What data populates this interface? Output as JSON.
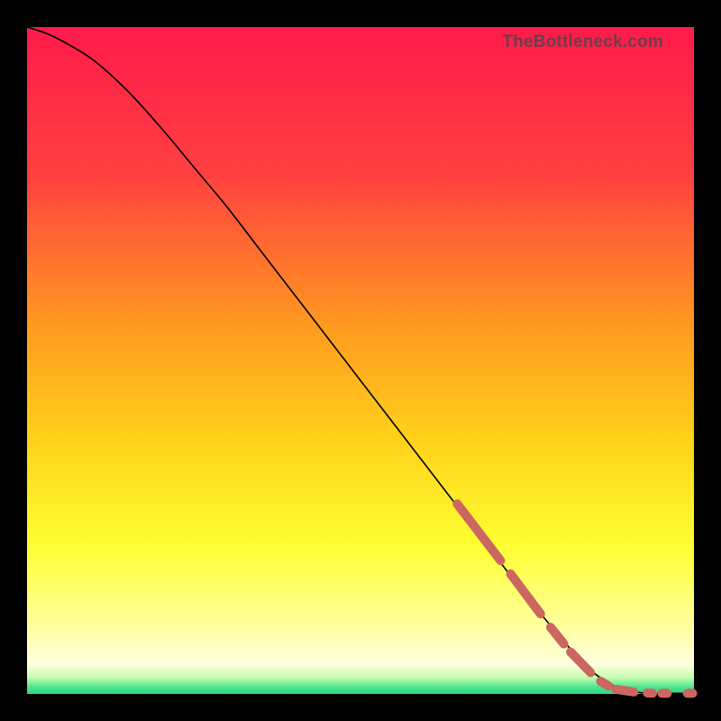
{
  "watermark": "TheBottleneck.com",
  "colors": {
    "curve": "#000000",
    "dash": "#cc6660",
    "gradient_stops": [
      {
        "offset": 0.0,
        "color": "#ff1a4b"
      },
      {
        "offset": 0.22,
        "color": "#ff4040"
      },
      {
        "offset": 0.45,
        "color": "#ff9a1f"
      },
      {
        "offset": 0.62,
        "color": "#ffd21a"
      },
      {
        "offset": 0.78,
        "color": "#ffff33"
      },
      {
        "offset": 0.9,
        "color": "#ffffa0"
      },
      {
        "offset": 0.955,
        "color": "#ffffe0"
      },
      {
        "offset": 0.975,
        "color": "#c8ffb0"
      },
      {
        "offset": 0.99,
        "color": "#4be38f"
      },
      {
        "offset": 1.0,
        "color": "#2bd884"
      }
    ]
  },
  "chart_data": {
    "type": "line",
    "title": "",
    "xlabel": "",
    "ylabel": "",
    "xlim": [
      0,
      100
    ],
    "ylim": [
      0,
      100
    ],
    "series": [
      {
        "name": "curve",
        "x": [
          0,
          3,
          6,
          10,
          15,
          20,
          25,
          30,
          35,
          40,
          45,
          50,
          55,
          60,
          65,
          70,
          75,
          80,
          84,
          88,
          92,
          96,
          100
        ],
        "y": [
          100,
          99,
          97.5,
          95,
          90.5,
          85,
          79,
          73,
          66.5,
          60,
          53.5,
          47,
          40.5,
          34,
          27.5,
          21,
          14.5,
          8.5,
          4,
          1.2,
          0.2,
          0.1,
          0.1
        ]
      }
    ],
    "dash_overlay": {
      "name": "highlight-dashes",
      "segments": [
        {
          "x1": 64.5,
          "y1": 28.5,
          "x2": 71.0,
          "y2": 20.0
        },
        {
          "x1": 72.5,
          "y1": 18.0,
          "x2": 77.0,
          "y2": 12.0
        },
        {
          "x1": 78.5,
          "y1": 10.0,
          "x2": 80.5,
          "y2": 7.5
        },
        {
          "x1": 81.5,
          "y1": 6.3,
          "x2": 84.5,
          "y2": 3.2
        },
        {
          "x1": 86.0,
          "y1": 1.9,
          "x2": 87.2,
          "y2": 1.2
        },
        {
          "x1": 88.3,
          "y1": 0.7,
          "x2": 91.0,
          "y2": 0.3
        },
        {
          "x1": 93.0,
          "y1": 0.15,
          "x2": 93.8,
          "y2": 0.12
        },
        {
          "x1": 95.2,
          "y1": 0.1,
          "x2": 96.0,
          "y2": 0.1
        },
        {
          "x1": 99.0,
          "y1": 0.1,
          "x2": 99.8,
          "y2": 0.1
        }
      ]
    }
  }
}
